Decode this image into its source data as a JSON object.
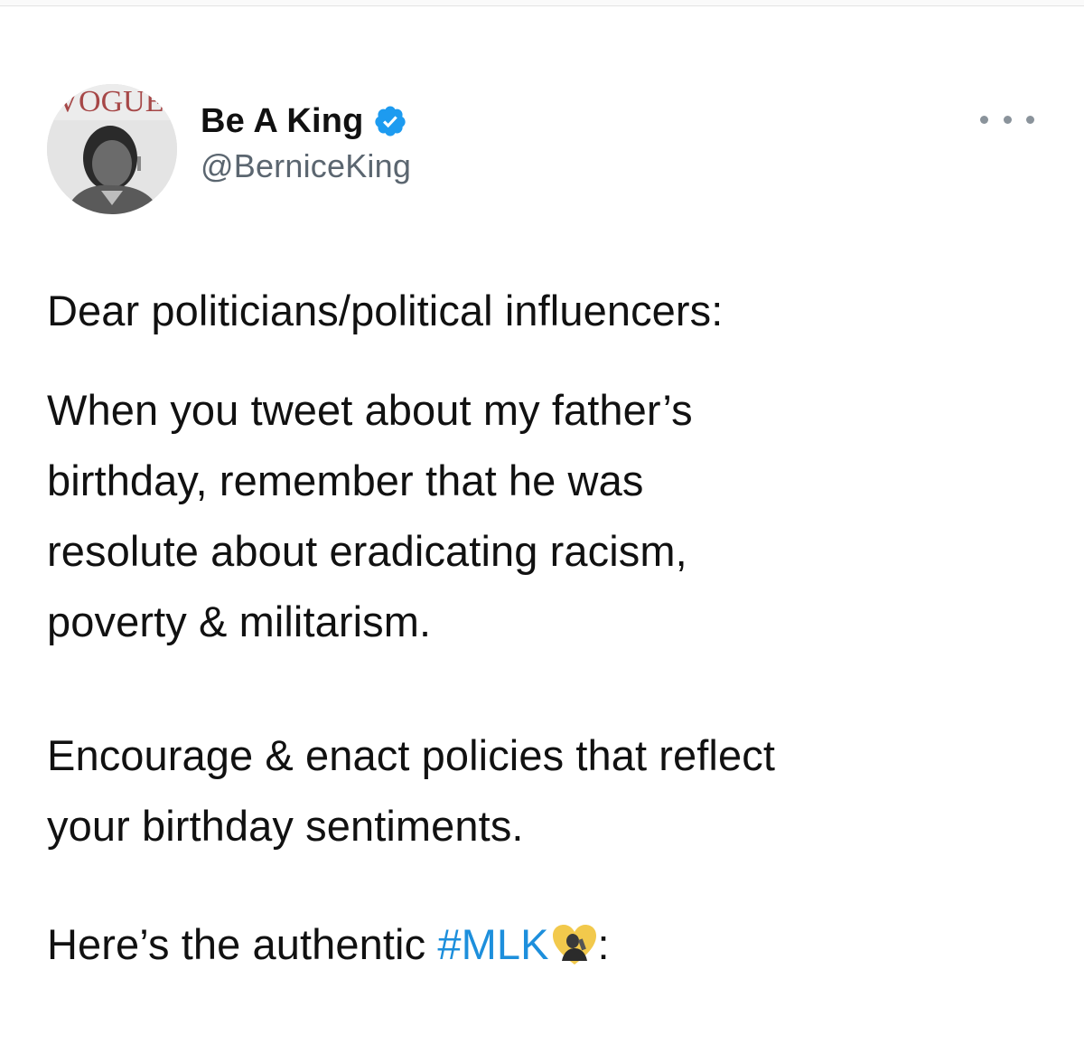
{
  "tweet": {
    "author": {
      "display_name": "Be A King",
      "handle": "@BerniceKing",
      "verified": true,
      "avatar_icon": "avatar-portrait-magazine-cover"
    },
    "more_icon": "more-horizontal-icon",
    "paragraphs": {
      "p1": "Dear politicians/political influencers:",
      "p2_lines": [
        "When you tweet about my father’s",
        "birthday, remember that he was",
        "resolute about eradicating racism,",
        "poverty & militarism."
      ],
      "p3_lines": [
        "Encourage & enact policies that reflect",
        "your birthday sentiments."
      ],
      "p4_prefix": "Here’s the authentic ",
      "p4_hashtag": "#MLK",
      "p4_suffix": ":"
    },
    "colors": {
      "hashtag": "#1d8fdc",
      "verified_badge": "#1d9bf0",
      "handle_gray": "#5b6670"
    }
  }
}
